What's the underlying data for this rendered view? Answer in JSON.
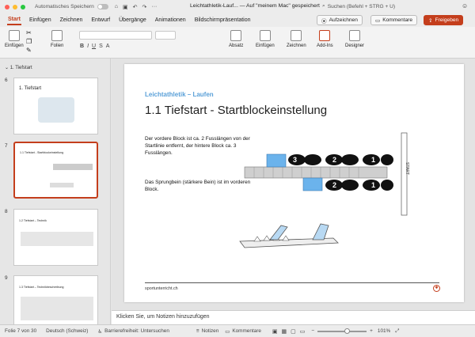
{
  "titlebar": {
    "autosave_label": "Automatisches Speichern",
    "doc_title": "Leichtathletik-Lauf... — Auf \"meinem Mac\" gespeichert",
    "search_placeholder": "Suchen (Befehl + STRG + U)"
  },
  "tabs": [
    {
      "label": "Start"
    },
    {
      "label": "Einfügen"
    },
    {
      "label": "Zeichnen"
    },
    {
      "label": "Entwurf"
    },
    {
      "label": "Übergänge"
    },
    {
      "label": "Animationen"
    },
    {
      "label": "Bildschirmpräsentation"
    }
  ],
  "tab_buttons": {
    "record": "Aufzeichnen",
    "comments": "Kommentare",
    "share": "Freigeben"
  },
  "ribbon": {
    "paste": "Einfügen",
    "slides": "Folien",
    "paragraph": "Absatz",
    "insert": "Einfügen",
    "draw": "Zeichnen",
    "addins": "Add-Ins",
    "designer": "Designer"
  },
  "sidebar": {
    "section": "1. Tiefstart",
    "slides": [
      {
        "num": "6",
        "title": "1. Tiefstart"
      },
      {
        "num": "7",
        "title": "1.1 Tiefstart - Startblockeinstellung",
        "selected": true
      },
      {
        "num": "8",
        "title": "1.2 Tiefstart – Technik"
      },
      {
        "num": "9",
        "title": "1.3 Tiefstart – Technikbeschreibung"
      }
    ]
  },
  "slide": {
    "subtitle": "Leichtathletik – Laufen",
    "title": "1.1 Tiefstart - Startblockeinstellung",
    "para1": "Der vordere Block ist ca. 2 Fusslängen von der Startlinie entfernt, der hintere Block ca. 3 Fusslängen.",
    "para2": "Das Sprungbein (stärkere Bein) ist im vorderen Block.",
    "footer": "sportunterricht.ch",
    "start_label": "START",
    "steps": [
      "3",
      "2",
      "1",
      "2",
      "1"
    ]
  },
  "notes_placeholder": "Klicken Sie, um Notizen hinzuzufügen",
  "status": {
    "slide_info": "Folie 7 von 30",
    "language": "Deutsch (Schweiz)",
    "accessibility": "Barrierefreiheit: Untersuchen",
    "notes": "Notizen",
    "comments": "Kommentare",
    "zoom": "101%"
  },
  "colors": {
    "accent": "#c43e1c",
    "slide_subtitle": "#5aa0d8",
    "block_blue": "#6bb3ec"
  }
}
